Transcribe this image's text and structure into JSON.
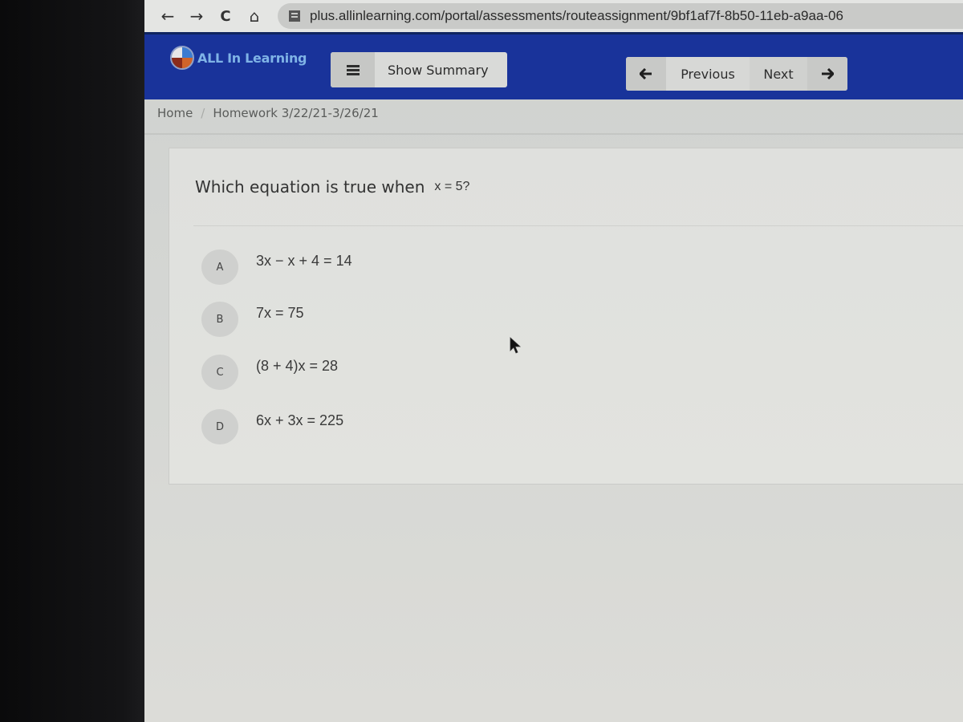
{
  "browser": {
    "back_icon": "arrow-left-icon",
    "forward_icon": "arrow-right-icon",
    "reload_icon": "reload-icon",
    "home_icon": "home-icon",
    "back_glyph": "←",
    "forward_glyph": "→",
    "reload_glyph": "C",
    "home_glyph": "⌂",
    "url": "plus.allinlearning.com/portal/assessments/routeassignment/9bf1af7f-8b50-11eb-a9aa-06"
  },
  "header": {
    "brand": "ALL In Learning",
    "show_summary_label": "Show Summary",
    "previous_label": "Previous",
    "next_label": "Next",
    "prev_arrow": "🡐",
    "next_arrow": "🡒",
    "brand_color": "#19339a"
  },
  "breadcrumb": {
    "items": [
      "Home",
      "Homework 3/22/21-3/26/21"
    ],
    "separator": "/"
  },
  "question": {
    "prompt": "Which equation is true when",
    "math": "x = 5?",
    "choices": [
      {
        "letter": "A",
        "expression": "3x − x + 4 = 14"
      },
      {
        "letter": "B",
        "expression": "7x = 75"
      },
      {
        "letter": "C",
        "expression": "(8 + 4)x = 28"
      },
      {
        "letter": "D",
        "expression": "6x + 3x = 225"
      }
    ]
  }
}
